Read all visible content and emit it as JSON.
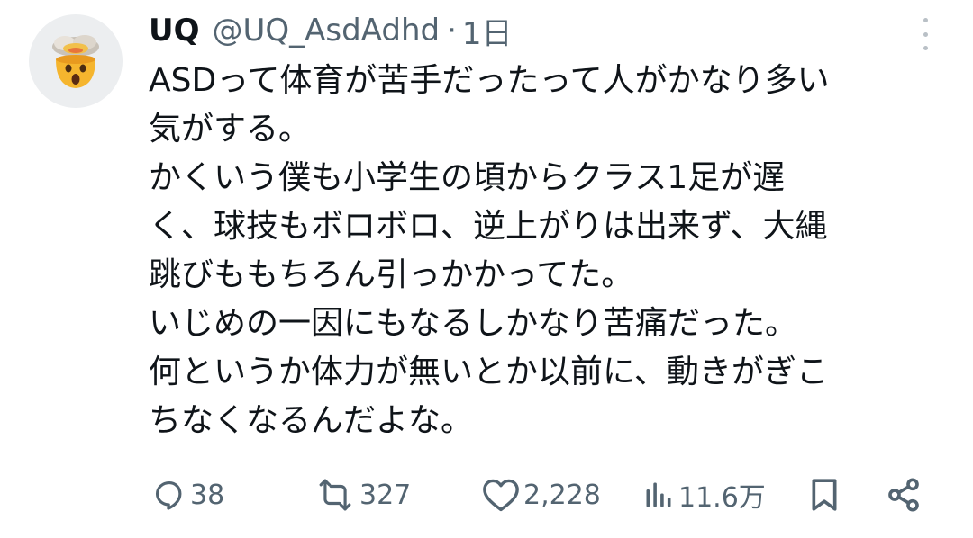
{
  "tweet": {
    "author_name": "UQ",
    "handle": "@UQ_AsdAdhd",
    "separator": "·",
    "time": "1日",
    "avatar_icon": "exploding-head-emoji-icon",
    "more_icon": "vertical-ellipsis-icon",
    "text_lines": [
      "ASDって体育が苦手だったって人がかなり多い",
      "気がする。",
      "かくいう僕も小学生の頃からクラス1足が遅",
      "く、球技もボロボロ、逆上がりは出来ず、大縄",
      "跳びももちろん引っかかってた。",
      "いじめの一因にもなるしかなり苦痛だった。",
      "何というか体力が無いとか以前に、動きがぎこ",
      "ちなくなるんだよな。"
    ]
  },
  "actions": {
    "reply": {
      "icon": "reply-icon",
      "count": "38"
    },
    "retweet": {
      "icon": "retweet-icon",
      "count": "327"
    },
    "like": {
      "icon": "heart-icon",
      "count": "2,228"
    },
    "views": {
      "icon": "views-chart-icon",
      "count": "11.6万"
    },
    "bookmark": {
      "icon": "bookmark-icon"
    },
    "share": {
      "icon": "share-icon"
    }
  },
  "colors": {
    "text": "#0f1419",
    "secondary": "#536471",
    "avatar_bg": "#eceef0"
  }
}
